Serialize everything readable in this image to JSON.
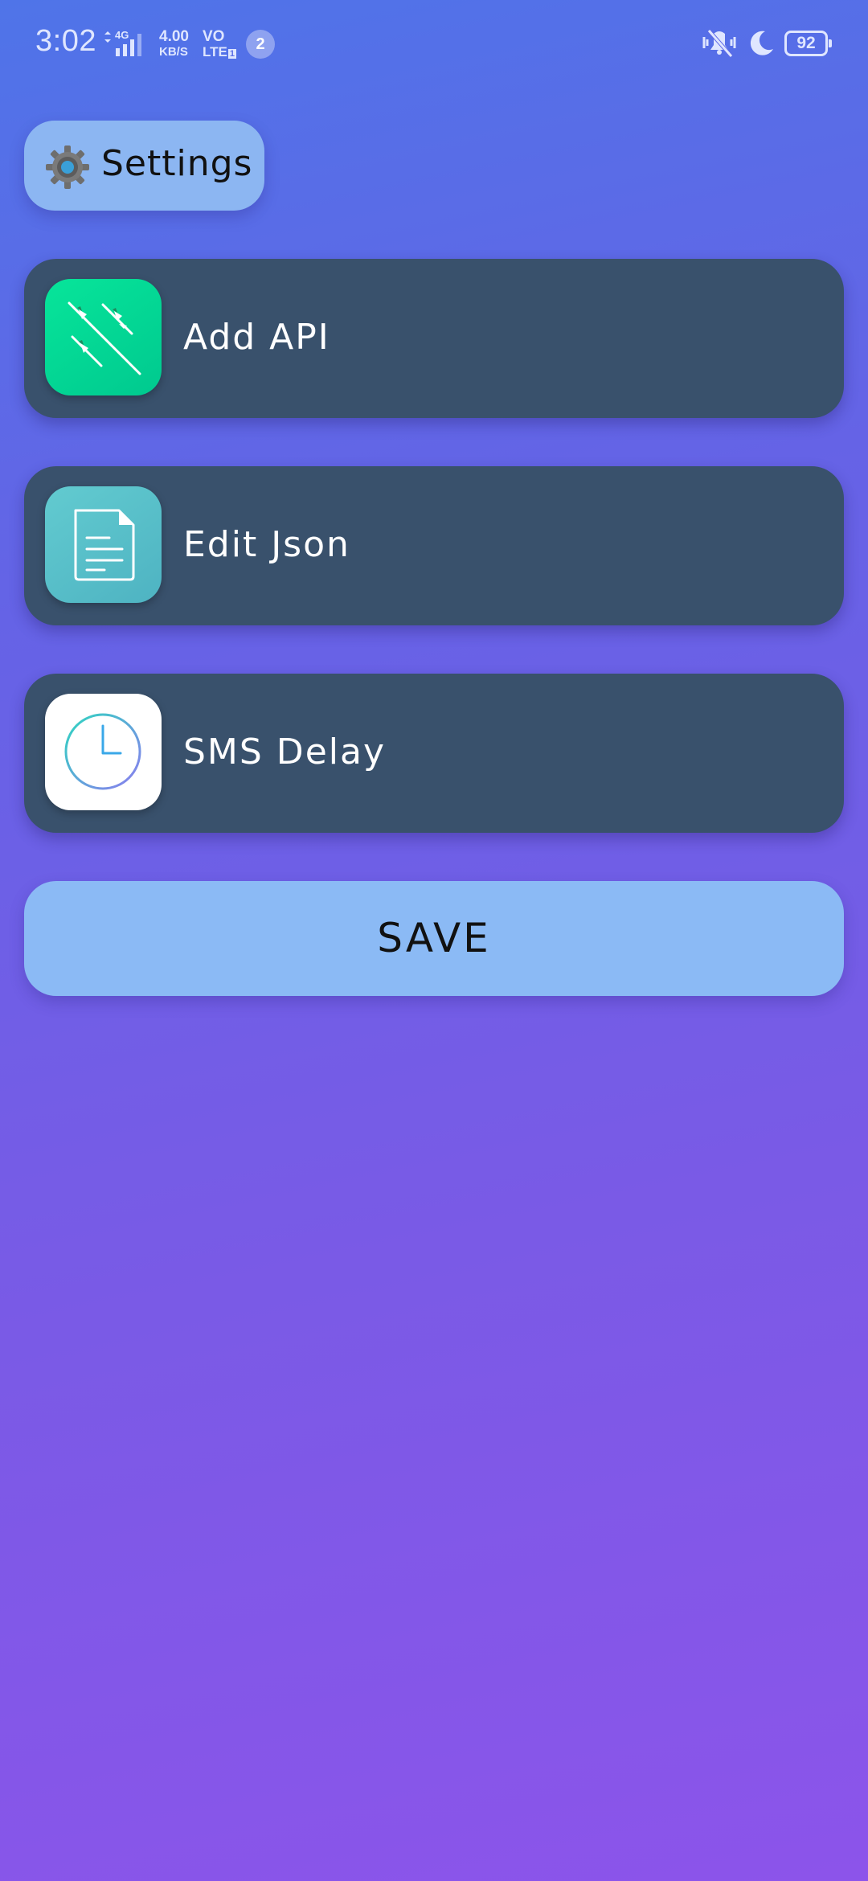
{
  "status_bar": {
    "time": "3:02",
    "network_type": "4G",
    "speed_value": "4.00",
    "speed_unit": "KB/S",
    "volte_top": "VO",
    "volte_bottom": "LTE",
    "volte_sim": "1",
    "notification_count": "2",
    "battery_level": "92",
    "icons": [
      "signal-icon",
      "vibrate-off-icon",
      "moon-icon",
      "battery-icon"
    ]
  },
  "header": {
    "settings_label": "Settings",
    "settings_icon": "gear-icon"
  },
  "menu": {
    "items": [
      {
        "label": "Add API",
        "icon": "api-connector-icon",
        "icon_color": "#00d696"
      },
      {
        "label": "Edit Json",
        "icon": "document-icon",
        "icon_color": "#58c0c9"
      },
      {
        "label": "SMS Delay",
        "icon": "clock-icon",
        "icon_color": "#ffffff"
      }
    ]
  },
  "actions": {
    "save_label": "SAVE"
  },
  "colors": {
    "background_top": "#4f74e8",
    "background_bottom": "#8c54ea",
    "card": "#39516c",
    "accent_button": "#8bbaf5"
  }
}
